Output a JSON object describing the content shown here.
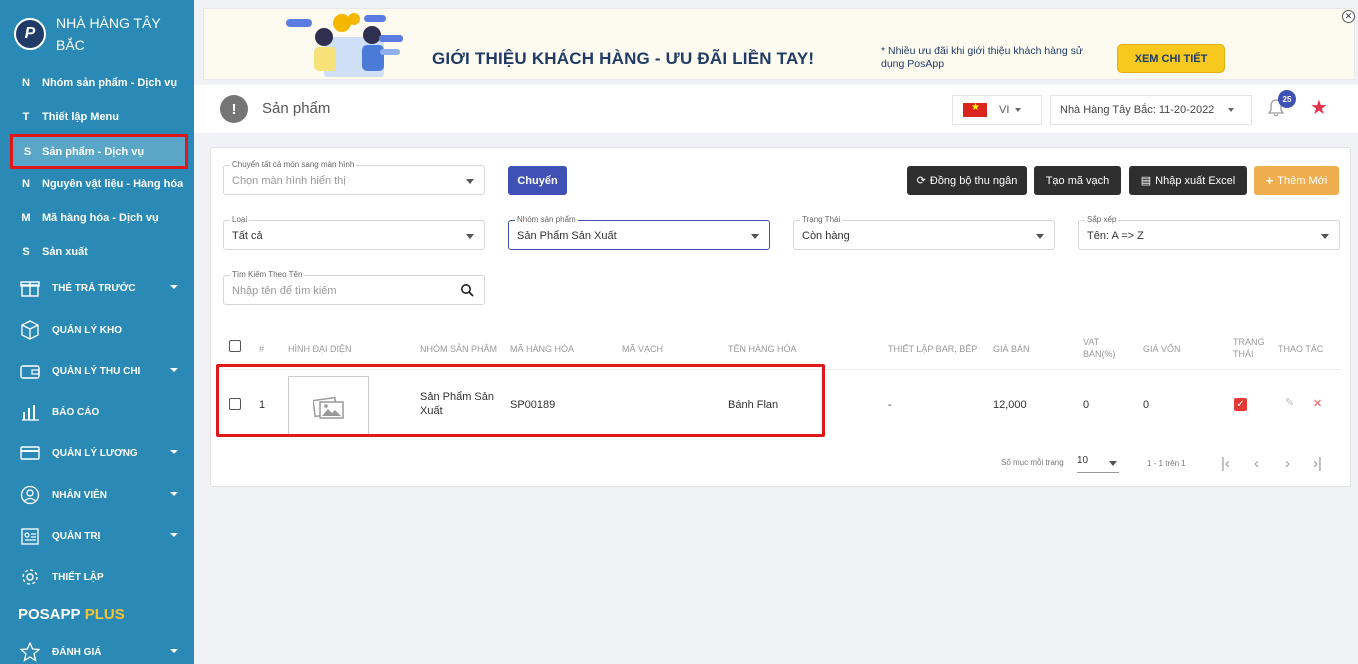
{
  "sidebar": {
    "brand_name": "NHÀ HÀNG TÂY BẮC",
    "logo_letter": "P",
    "sub_items": [
      {
        "letter": "N",
        "label": "Nhóm sản phẩm - Dịch vụ"
      },
      {
        "letter": "T",
        "label": "Thiết lập Menu"
      },
      {
        "letter": "S",
        "label": "Sản phẩm - Dịch vụ"
      },
      {
        "letter": "N",
        "label": "Nguyên vật liệu - Hàng hóa"
      },
      {
        "letter": "M",
        "label": "Mã hàng hóa - Dịch vụ"
      },
      {
        "letter": "S",
        "label": "Sản xuất"
      }
    ],
    "menu": [
      {
        "label": "THẺ TRẢ TRƯỚC",
        "icon": "gift-icon"
      },
      {
        "label": "QUẢN LÝ KHO",
        "icon": "box-icon"
      },
      {
        "label": "QUẢN LÝ THU CHI",
        "icon": "wallet-icon"
      },
      {
        "label": "BÁO CÁO",
        "icon": "bar-chart-icon"
      },
      {
        "label": "QUẢN LÝ LƯƠNG",
        "icon": "credit-card-icon"
      },
      {
        "label": "NHÂN VIÊN",
        "icon": "user-icon"
      },
      {
        "label": "QUẢN TRỊ",
        "icon": "admin-icon"
      },
      {
        "label": "THIẾT LẬP",
        "icon": "gear-icon"
      },
      {
        "label": "ĐÁNH GIÁ",
        "icon": "star-icon"
      }
    ],
    "plus_brand": "POSAPP",
    "plus_word": "PLUS"
  },
  "banner": {
    "headline": "GIỚI THIỆU KHÁCH HÀNG - ƯU ĐÃI LIỀN TAY!",
    "note": "* Nhiều ưu đãi khi giới thiệu khách hàng sử dụng PosApp",
    "cta": "XEM CHI TIẾT",
    "close": "✕"
  },
  "header": {
    "title": "Sản phẩm",
    "info_glyph": "!",
    "language": "VI",
    "store": "Nhà Hàng Tây Bắc: 11-20-2022",
    "notification_count": "25"
  },
  "filters": {
    "transfer_label": "Chuyển tất cả món sang màn hình",
    "transfer_placeholder": "Chọn màn hình hiển thị",
    "transfer_button": "Chuyển",
    "sync_button": "Đồng bộ thu ngân",
    "barcode_button": "Tạo mã vạch",
    "excel_button": "Nhập xuất Excel",
    "add_button": "Thêm Mới",
    "type_label": "Loại",
    "type_value": "Tất cả",
    "group_label": "Nhóm sản phẩm",
    "group_value": "Sản Phẩm Sản Xuất",
    "status_label": "Trạng Thái",
    "status_value": "Còn hàng",
    "sort_label": "Sắp xếp",
    "sort_value": "Tên: A => Z",
    "search_label": "Tìm Kiếm Theo Tên",
    "search_placeholder": "Nhập tên để tìm kiếm"
  },
  "table": {
    "headers": [
      "#",
      "HÌNH ĐẠI DIỆN",
      "NHÓM SẢN PHẨM",
      "MÃ HÀNG HÓA",
      "MÃ VẠCH",
      "TÊN HÀNG HÓA",
      "THIẾT LẬP BAR, BẾP",
      "GIÁ BÁN",
      "VAT BÁN(%)",
      "GIÁ VỐN",
      "TRẠNG THÁI",
      "THAO TÁC"
    ],
    "rows": [
      {
        "index": "1",
        "group": "Sản Phẩm Sản Xuất",
        "code": "SP00189",
        "barcode": "",
        "name": "Bánh Flan",
        "bar_kitchen": "-",
        "price": "12,000",
        "vat": "0",
        "cost": "0",
        "active": true
      }
    ]
  },
  "pagination": {
    "per_page_label": "Số mục mỗi trang",
    "per_page_value": "10",
    "range": "1 - 1 trên 1"
  },
  "colors": {
    "sidebar": "#2a8ab5",
    "primary": "#3f51b5",
    "highlight": "#e0181a",
    "accent_star": "#e0334c"
  }
}
